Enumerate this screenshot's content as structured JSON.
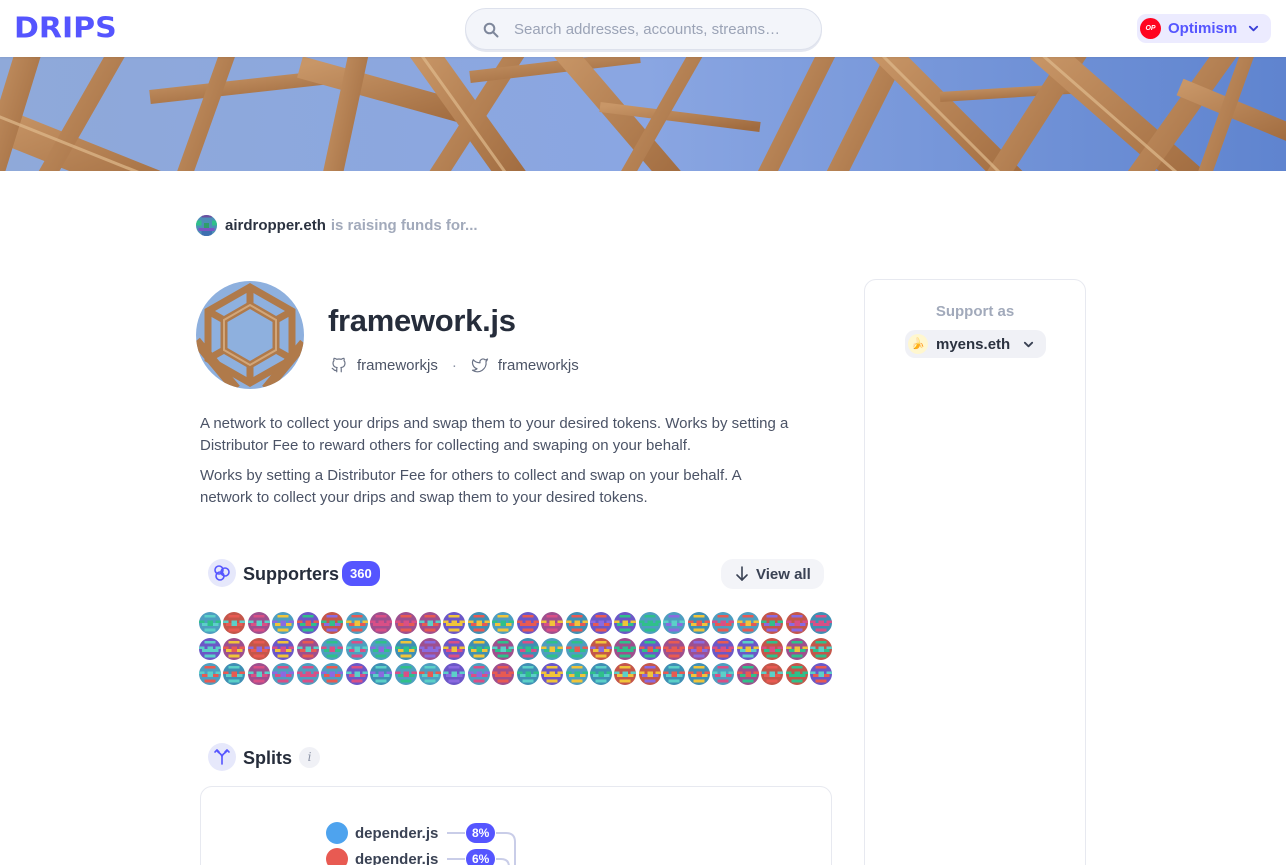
{
  "header": {
    "logo": "DRIPS",
    "search_placeholder": "Search addresses, accounts, streams…",
    "network_badge": "OP",
    "network": "Optimism"
  },
  "owner": {
    "name": "airdropper.eth",
    "raising_text": "is raising funds for..."
  },
  "project": {
    "name": "framework.js",
    "github": "frameworkjs",
    "twitter": "frameworkjs",
    "separator": "·",
    "description": [
      "A network to collect your drips and swap them to your desired tokens. Works by setting a Distributor Fee to reward others for collecting and swaping on your behalf.",
      "Works by setting a Distributor Fee for others to collect and swap on your behalf. A network to collect your drips and swap them to your desired tokens."
    ]
  },
  "supporters": {
    "title": "Supporters",
    "count": "360",
    "view_all": "View all",
    "rows": 3,
    "per_row": 26
  },
  "splits": {
    "title": "Splits",
    "info": "i",
    "items": [
      {
        "name": "depender.js",
        "percent": "8%",
        "color": "#4ea3ee"
      },
      {
        "name": "depender.js",
        "percent": "6%",
        "color": "#e85a52"
      }
    ]
  },
  "support": {
    "label": "Support as",
    "identity_emoji": "🍌",
    "identity": "myens.eth"
  },
  "colors": {
    "accent": "#5555ff",
    "text": "#2b3240",
    "muted": "#a2aabb"
  }
}
